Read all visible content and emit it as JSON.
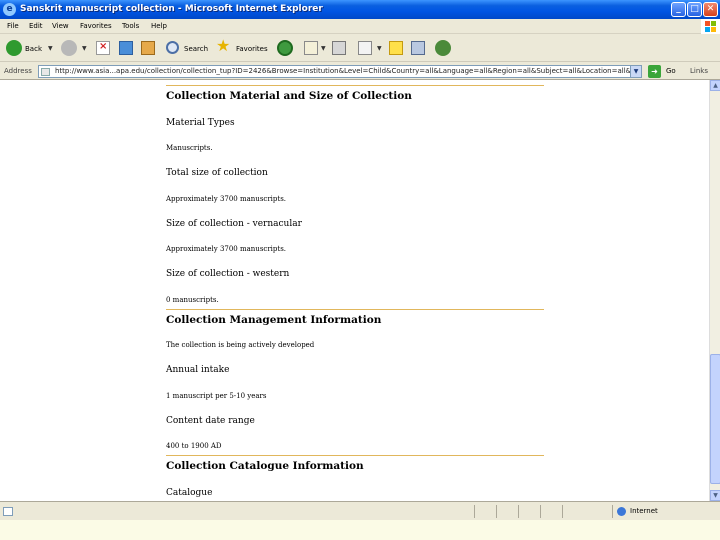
{
  "window": {
    "title": "Sanskrit manuscript collection - Microsoft Internet Explorer",
    "buttons": {
      "minimize": "_",
      "maximize": "□",
      "close": "✕"
    }
  },
  "menu": [
    "File",
    "Edit",
    "View",
    "Favorites",
    "Tools",
    "Help"
  ],
  "toolbar": {
    "back_label": "Back",
    "search_label": "Search",
    "favorites_label": "Favorites"
  },
  "address": {
    "label": "Address",
    "url": "http://www.asia...apa.edu/collection/collection_tup?ID=2426&Browse=Institution&Level=Child&Country=all&Language=all&Region=all&Subject=all&Location=all&Institutio",
    "go_label": "Go",
    "links_label": "Links"
  },
  "content": {
    "sections": [
      {
        "heading": "Collection Material and Size of Collection",
        "fields": [
          {
            "label": "Material Types",
            "value": "Manuscripts."
          },
          {
            "label": "Total size of collection",
            "value": "Approximately 3700 manuscripts."
          },
          {
            "label": "Size of collection - vernacular",
            "value": "Approximately 3700 manuscripts."
          },
          {
            "label": "Size of collection - western",
            "value": "0 manuscripts."
          }
        ]
      },
      {
        "heading": "Collection Management Information",
        "intro": "The collection is being actively developed",
        "fields": [
          {
            "label": "Annual intake",
            "value": "1 manuscript per 5-10 years"
          },
          {
            "label": "Content date range",
            "value": "400 to 1900 AD"
          }
        ]
      },
      {
        "heading": "Collection Catalogue Information",
        "fields": [
          {
            "label": "Catalogue",
            "value": ""
          }
        ]
      }
    ]
  },
  "status": {
    "zone": "Internet"
  }
}
